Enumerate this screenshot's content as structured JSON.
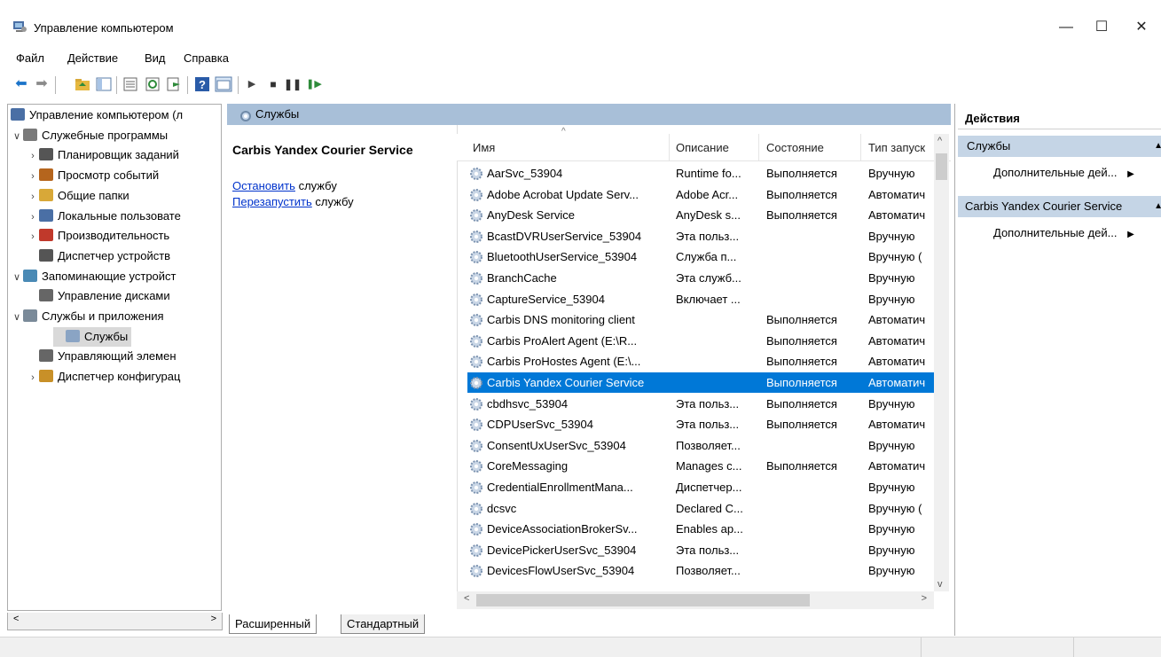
{
  "window": {
    "title": "Управление компьютером",
    "minimize_glyph": "—",
    "maximize_glyph": "☐",
    "close_glyph": "✕"
  },
  "menu": [
    "Файл",
    "Действие",
    "Вид",
    "Справка"
  ],
  "tree": {
    "items": [
      {
        "label": "Управление компьютером (л",
        "indent": 0,
        "arrow": "",
        "icon": "computer-management-icon",
        "color": "#4a6fa5"
      },
      {
        "label": "Служебные программы",
        "indent": 1,
        "arrow": "v",
        "icon": "tools-icon",
        "color": "#7a7a7a"
      },
      {
        "label": "Планировщик заданий",
        "indent": 2,
        "arrow": ">",
        "icon": "clock-icon",
        "color": "#555555"
      },
      {
        "label": "Просмотр событий",
        "indent": 2,
        "arrow": ">",
        "icon": "event-viewer-icon",
        "color": "#b5651d"
      },
      {
        "label": "Общие папки",
        "indent": 2,
        "arrow": ">",
        "icon": "shared-folder-icon",
        "color": "#d8a838"
      },
      {
        "label": "Локальные пользовате",
        "indent": 2,
        "arrow": ">",
        "icon": "users-icon",
        "color": "#4a6fa5"
      },
      {
        "label": "Производительность",
        "indent": 2,
        "arrow": ">",
        "icon": "performance-icon",
        "color": "#c0392b"
      },
      {
        "label": "Диспетчер устройств",
        "indent": 2,
        "arrow": "",
        "icon": "device-manager-icon",
        "color": "#555555"
      },
      {
        "label": "Запоминающие устройст",
        "indent": 1,
        "arrow": "v",
        "icon": "storage-icon",
        "color": "#4a8ab5"
      },
      {
        "label": "Управление дисками",
        "indent": 2,
        "arrow": "",
        "icon": "disk-icon",
        "color": "#666666"
      },
      {
        "label": "Службы и приложения",
        "indent": 1,
        "arrow": "v",
        "icon": "services-apps-icon",
        "color": "#7a8a99"
      },
      {
        "label": "Службы",
        "indent": 2,
        "arrow": "",
        "icon": "services-icon",
        "color": "#8aa4c4",
        "selected": true
      },
      {
        "label": "Управляющий элемен",
        "indent": 2,
        "arrow": "",
        "icon": "wmi-icon",
        "color": "#666666"
      },
      {
        "label": "Диспетчер конфигурац",
        "indent": 2,
        "arrow": ">",
        "icon": "config-manager-icon",
        "color": "#c89028"
      }
    ]
  },
  "mid": {
    "header": "Службы",
    "detail_title": "Carbis Yandex Courier Service",
    "stop_link": "Остановить",
    "stop_rest": " службу",
    "restart_link": "Перезапустить",
    "restart_rest": " службу"
  },
  "list": {
    "columns": [
      "Имя",
      "Описание",
      "Состояние",
      "Тип запуск"
    ],
    "rows": [
      {
        "name": "AarSvc_53904",
        "desc": "Runtime fo...",
        "state": "Выполняется",
        "start": "Вручную"
      },
      {
        "name": "Adobe Acrobat Update Serv...",
        "desc": "Adobe Acr...",
        "state": "Выполняется",
        "start": "Автоматич"
      },
      {
        "name": "AnyDesk Service",
        "desc": "AnyDesk s...",
        "state": "Выполняется",
        "start": "Автоматич"
      },
      {
        "name": "BcastDVRUserService_53904",
        "desc": "Эта польз...",
        "state": "",
        "start": "Вручную"
      },
      {
        "name": "BluetoothUserService_53904",
        "desc": "Служба п...",
        "state": "",
        "start": "Вручную ("
      },
      {
        "name": "BranchCache",
        "desc": "Эта служб...",
        "state": "",
        "start": "Вручную"
      },
      {
        "name": "CaptureService_53904",
        "desc": "Включает ...",
        "state": "",
        "start": "Вручную"
      },
      {
        "name": "Carbis DNS monitoring client",
        "desc": "",
        "state": "Выполняется",
        "start": "Автоматич"
      },
      {
        "name": "Carbis ProAlert Agent (E:\\R...",
        "desc": "",
        "state": "Выполняется",
        "start": "Автоматич"
      },
      {
        "name": "Carbis ProHostes Agent (E:\\...",
        "desc": "",
        "state": "Выполняется",
        "start": "Автоматич"
      },
      {
        "name": "Carbis Yandex Courier Service",
        "desc": "",
        "state": "Выполняется",
        "start": "Автоматич",
        "selected": true
      },
      {
        "name": "cbdhsvc_53904",
        "desc": "Эта польз...",
        "state": "Выполняется",
        "start": "Вручную"
      },
      {
        "name": "CDPUserSvc_53904",
        "desc": "Эта польз...",
        "state": "Выполняется",
        "start": "Автоматич"
      },
      {
        "name": "ConsentUxUserSvc_53904",
        "desc": "Позволяет...",
        "state": "",
        "start": "Вручную"
      },
      {
        "name": "CoreMessaging",
        "desc": "Manages c...",
        "state": "Выполняется",
        "start": "Автоматич"
      },
      {
        "name": "CredentialEnrollmentMana...",
        "desc": "Диспетчер...",
        "state": "",
        "start": "Вручную"
      },
      {
        "name": "dcsvc",
        "desc": "Declared C...",
        "state": "",
        "start": "Вручную ("
      },
      {
        "name": "DeviceAssociationBrokerSv...",
        "desc": "Enables ap...",
        "state": "",
        "start": "Вручную"
      },
      {
        "name": "DevicePickerUserSvc_53904",
        "desc": "Эта польз...",
        "state": "",
        "start": "Вручную"
      },
      {
        "name": "DevicesFlowUserSvc_53904",
        "desc": "Позволяет...",
        "state": "",
        "start": "Вручную"
      }
    ]
  },
  "tabs": [
    "Расширенный",
    "Стандартный"
  ],
  "actions": {
    "title": "Действия",
    "section1": "Службы",
    "more1": "Дополнительные дей...",
    "section2": "Carbis Yandex Courier Service",
    "more2": "Дополнительные дей..."
  },
  "colors": {
    "selection": "#0078d7",
    "pane_header": "#a8bfd8",
    "action_header": "#c5d5e6"
  }
}
